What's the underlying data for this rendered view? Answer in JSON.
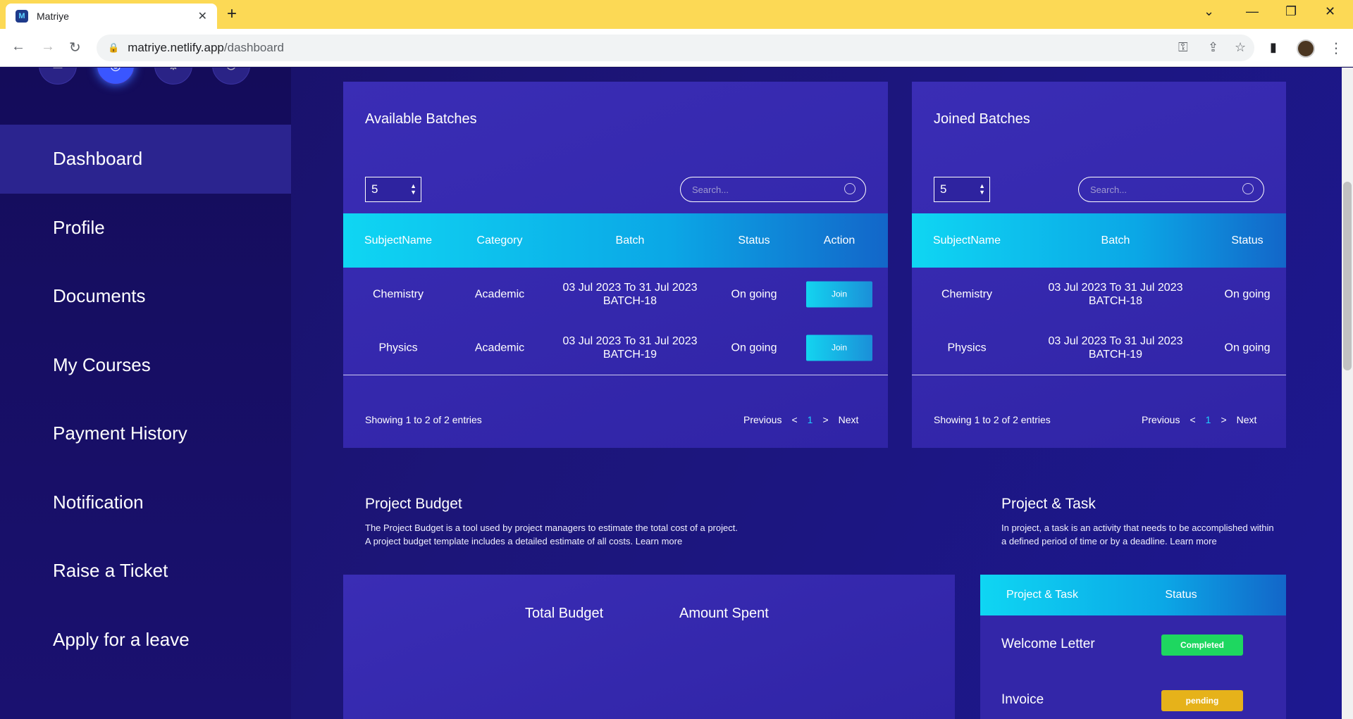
{
  "browser": {
    "tab_title": "Matriye",
    "url_host": "matriye.netlify.app",
    "url_path": "/dashboard"
  },
  "sidebar": {
    "items": [
      {
        "label": "Dashboard",
        "active": true
      },
      {
        "label": "Profile"
      },
      {
        "label": "Documents"
      },
      {
        "label": "My Courses"
      },
      {
        "label": "Payment History"
      },
      {
        "label": "Notification"
      },
      {
        "label": "Raise a Ticket"
      },
      {
        "label": "Apply for a leave"
      }
    ]
  },
  "available": {
    "title": "Available Batches",
    "page_size": "5",
    "search_placeholder": "Search...",
    "columns": [
      "SubjectName",
      "Category",
      "Batch",
      "Status",
      "Action"
    ],
    "rows": [
      {
        "subject": "Chemistry",
        "category": "Academic",
        "batch_dates": "03 Jul 2023 To 31 Jul 2023",
        "batch_name": "BATCH-18",
        "status": "On going",
        "action": "Join"
      },
      {
        "subject": "Physics",
        "category": "Academic",
        "batch_dates": "03 Jul 2023 To 31 Jul 2023",
        "batch_name": "BATCH-19",
        "status": "On going",
        "action": "Join"
      }
    ],
    "footer": "Showing 1 to 2 of 2 entries",
    "pager": {
      "prev": "Previous",
      "lt": "<",
      "page": "1",
      "gt": ">",
      "next": "Next"
    }
  },
  "joined": {
    "title": "Joined Batches",
    "page_size": "5",
    "search_placeholder": "Search...",
    "columns": [
      "SubjectName",
      "Batch",
      "Status"
    ],
    "rows": [
      {
        "subject": "Chemistry",
        "batch_dates": "03 Jul 2023 To 31 Jul 2023",
        "batch_name": "BATCH-18",
        "status": "On going"
      },
      {
        "subject": "Physics",
        "batch_dates": "03 Jul 2023 To 31 Jul 2023",
        "batch_name": "BATCH-19",
        "status": "On going"
      }
    ],
    "footer": "Showing 1 to 2 of 2 entries",
    "pager": {
      "prev": "Previous",
      "lt": "<",
      "page": "1",
      "gt": ">",
      "next": "Next"
    }
  },
  "budget": {
    "title": "Project Budget",
    "desc_line1": "The Project Budget is a tool used by project managers to estimate the total cost of a project.",
    "desc_line2": "A project budget template includes a detailed estimate of all costs. Learn more",
    "legend_total": "Total Budget",
    "legend_spent": "Amount Spent"
  },
  "tasks": {
    "title": "Project & Task",
    "desc_line1": "In project, a task is an activity that needs to be accomplished within",
    "desc_line2": "a defined period of time or by a deadline. Learn more",
    "columns": [
      "Project & Task",
      "Status"
    ],
    "rows": [
      {
        "name": "Welcome Letter",
        "status": "Completed",
        "color": "#1ed760"
      },
      {
        "name": "Invoice",
        "status": "pending",
        "color": "#e6b21a"
      }
    ]
  }
}
